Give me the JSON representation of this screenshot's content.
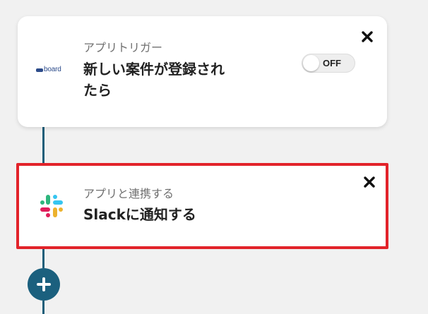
{
  "flow": {
    "trigger": {
      "app_icon": "board-logo",
      "app_logo_text": "board",
      "subtitle": "アプリトリガー",
      "title_line1": "新しい案件が登録され",
      "title_line2": "たら",
      "toggle_label": "OFF",
      "toggle_state": "off",
      "close_icon": "close-icon"
    },
    "action": {
      "app_icon": "slack-icon",
      "subtitle": "アプリと連携する",
      "title": "Slackに通知する",
      "close_icon": "close-icon",
      "highlight_color": "#e2232a"
    },
    "add_button_icon": "plus-icon"
  },
  "colors": {
    "connector": "#1f5f7a",
    "add_button": "#1b607e",
    "background": "#f1f1f1"
  }
}
